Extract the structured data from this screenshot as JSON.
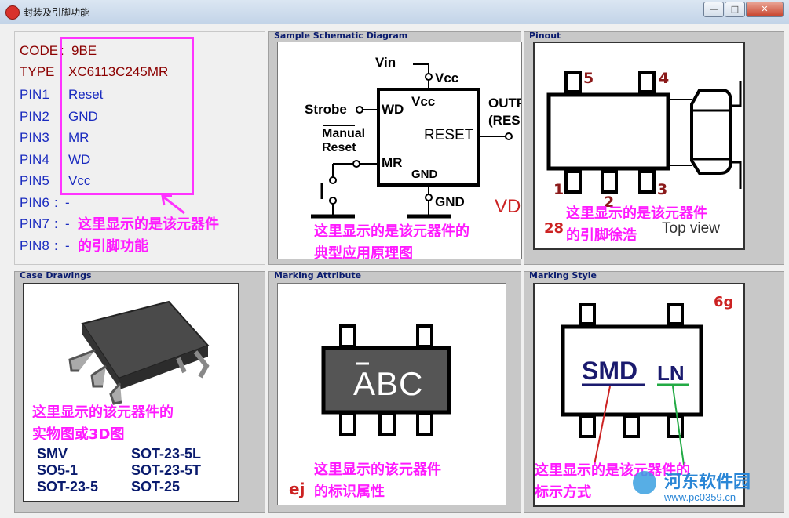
{
  "window": {
    "title": "封装及引脚功能",
    "minimize": "—",
    "maximize": "□",
    "close": "✕"
  },
  "info": {
    "code_label": "CODE",
    "code_value": "9BE",
    "type_label": "TYPE",
    "type_value": "XC6113C245MR",
    "pins": [
      {
        "label": "PIN1",
        "value": "Reset"
      },
      {
        "label": "PIN2",
        "value": "GND"
      },
      {
        "label": "PIN3",
        "value": "MR"
      },
      {
        "label": "PIN4",
        "value": "WD"
      },
      {
        "label": "PIN5",
        "value": "Vcc"
      },
      {
        "label": "PIN6",
        "value": "-"
      },
      {
        "label": "PIN7",
        "value": "-"
      },
      {
        "label": "PIN8",
        "value": "-"
      }
    ],
    "annotation_line1": "这里显示的是该元器件",
    "annotation_line2": "的引脚功能"
  },
  "schematic": {
    "title": "Sample Schematic Diagram",
    "labels": {
      "vin": "Vin",
      "vcc_top": "Vcc",
      "vcc_chip": "Vcc",
      "strobe": "Strobe",
      "wd": "WD",
      "manual": "Manual",
      "reset_in": "Reset",
      "mr": "MR",
      "reset": "RESET",
      "gnd_chip": "GND",
      "gnd": "GND",
      "outp": "OUTP",
      "res": "(RES",
      "vd": "VD"
    },
    "annotation_line1": "这里显示的是该元器件的",
    "annotation_line2": "典型应用原理图"
  },
  "pinout": {
    "title": "Pinout",
    "pins": [
      "5",
      "4",
      "1",
      "2",
      "3"
    ],
    "part_number": "28",
    "top_view": "Top view",
    "annotation_line1": "这里显示的是该元器件",
    "annotation_line2": "的引脚徐浩"
  },
  "case": {
    "title": "Case Drawings",
    "annotation_line1": "这里显示的该元器件的",
    "annotation_line2": "实物图或3D图",
    "packages": [
      "SMV",
      "SOT-23-5L",
      "SO5-1",
      "SOT-23-5T",
      "SOT-23-5",
      "SOT-25"
    ]
  },
  "marking_attr": {
    "title": "Marking Attribute",
    "chip_text": "ABC",
    "code": "ej",
    "annotation_line1": "这里显示的该元器件",
    "annotation_line2": "的标识属性"
  },
  "marking_style": {
    "title": "Marking Style",
    "code": "6g",
    "smd": "SMD",
    "ln": "LN",
    "annotation_line1": "这里显示的是该元器件的",
    "annotation_line2": "标示方式",
    "watermark_site": "河东软件园",
    "watermark_url": "www.pc0359.cn"
  },
  "colors": {
    "annotation": "#ff1aff",
    "code_label": "#8b0000",
    "pin_label": "#1a2bbf",
    "panel_bg": "#c8c8c8",
    "pinout_numbers": "#8b1a1a"
  }
}
